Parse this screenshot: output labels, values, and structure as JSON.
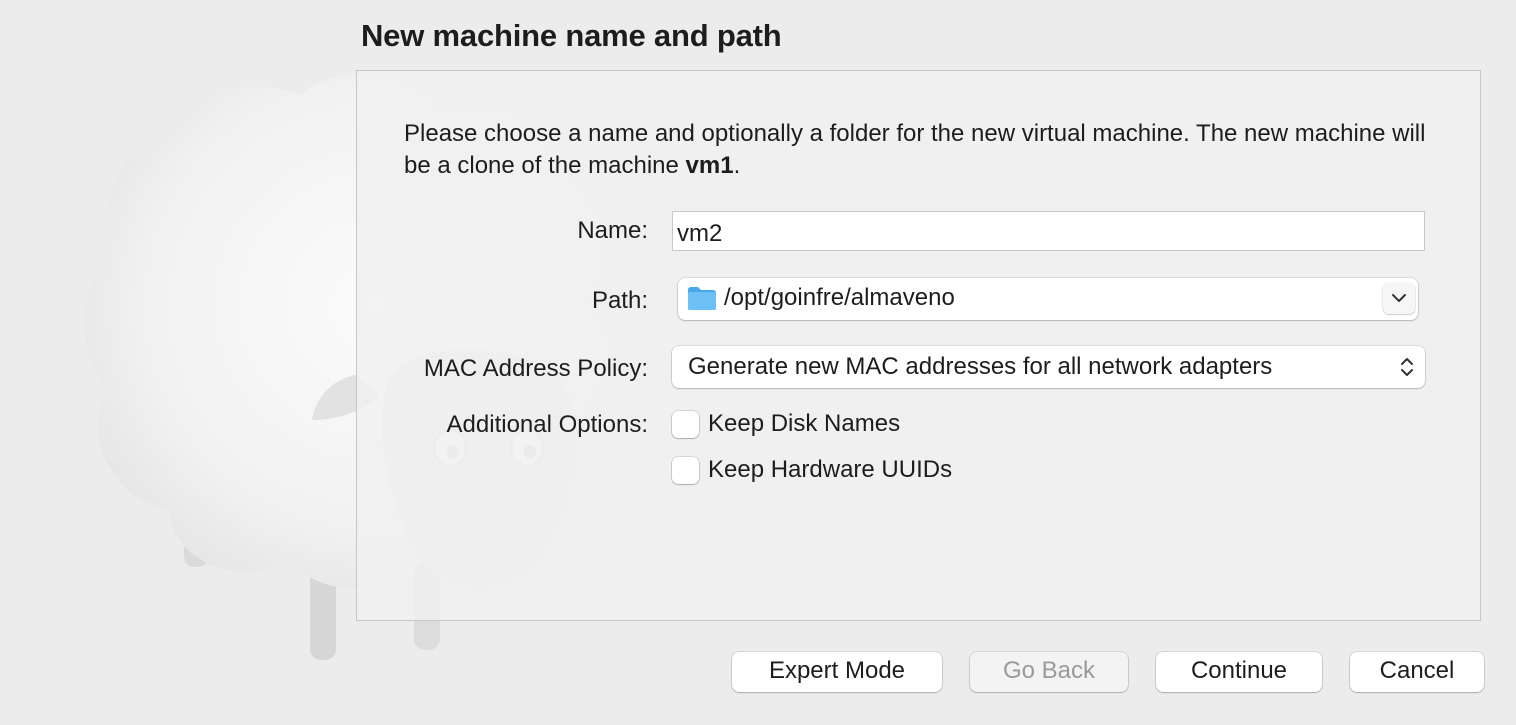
{
  "dialog": {
    "title": "New machine name and path",
    "description_prefix": "Please choose a name and optionally a folder for the new virtual machine. The new machine will be a clone of the machine ",
    "description_machine": "vm1",
    "description_suffix": "."
  },
  "form": {
    "name_label": "Name:",
    "name_value": "vm2",
    "path_label": "Path:",
    "path_value": "/opt/goinfre/almaveno",
    "path_icon": "folder-icon",
    "mac_label": "MAC Address Policy:",
    "mac_value": "Generate new MAC addresses for all network adapters",
    "options_label": "Additional Options:",
    "options": [
      {
        "label": "Keep Disk Names",
        "checked": false
      },
      {
        "label": "Keep Hardware UUIDs",
        "checked": false
      }
    ]
  },
  "buttons": {
    "expert_mode": "Expert Mode",
    "go_back": "Go Back",
    "continue": "Continue",
    "cancel": "Cancel"
  },
  "colors": {
    "background": "#ececec",
    "folder_blue": "#5fb7f2"
  }
}
